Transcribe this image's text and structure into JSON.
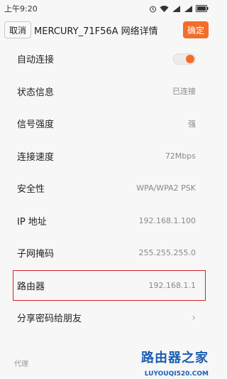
{
  "status_bar": {
    "time": "上午9:20"
  },
  "header": {
    "cancel_label": "取消",
    "title": "MERCURY_71F56A 网络详情",
    "confirm_label": "确定"
  },
  "colors": {
    "accent": "#f46e2a",
    "highlight_border": "#d2232a"
  },
  "rows": [
    {
      "label": "自动连接",
      "toggle_on": true
    },
    {
      "label": "状态信息",
      "value": "已连接"
    },
    {
      "label": "信号强度",
      "value": "强"
    },
    {
      "label": "连接速度",
      "value": "72Mbps"
    },
    {
      "label": "安全性",
      "value": "WPA/WPA2 PSK"
    },
    {
      "label": "IP 地址",
      "value": "192.168.1.100"
    },
    {
      "label": "子网掩码",
      "value": "255.255.255.0"
    },
    {
      "label": "路由器",
      "value": "192.168.1.1",
      "highlighted": true
    },
    {
      "label": "分享密码给朋友",
      "chevron": true
    }
  ],
  "section_label": "代理",
  "watermark": {
    "title": "路由器之家",
    "url": "LUYOUQI520.COM"
  }
}
